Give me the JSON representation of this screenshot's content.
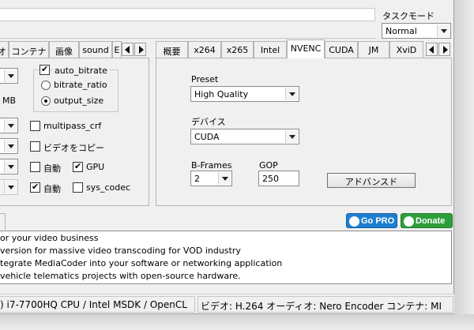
{
  "taskmode": {
    "label": "タスクモード",
    "value": "Normal"
  },
  "left_tabs": [
    "オ",
    "コンテナ",
    "画像",
    "sound",
    "E"
  ],
  "right_tabs": [
    "概要",
    "x264",
    "x265",
    "Intel",
    "NVENC",
    "CUDA",
    "JM",
    "XviD"
  ],
  "right_active_tab": "NVENC",
  "left_panel": {
    "mb_label": "MB",
    "auto_bitrate": "auto_bitrate",
    "bitrate_ratio": "bitrate_ratio",
    "output_size": "output_size",
    "multipass_crf": "multipass_crf",
    "copy_video": "ビデオをコピー",
    "auto1": "自動",
    "gpu": "GPU",
    "auto2": "自動",
    "sys_codec": "sys_codec"
  },
  "nvenc": {
    "preset_label": "Preset",
    "preset_value": "High Quality",
    "device_label": "デバイス",
    "device_value": "CUDA",
    "bframes_label": "B-Frames",
    "bframes_value": "2",
    "gop_label": "GOP",
    "gop_value": "250",
    "advanced_button": "アドバンスド"
  },
  "promo": {
    "gopro": "Go PRO",
    "donate": "Donate"
  },
  "news": [
    "or your video business",
    " version for massive video transcoding for VOD industry",
    "tegrate MediaCoder into your software or networking application",
    "vehicle telematics projects with open-source hardware."
  ],
  "status": {
    "cpu": ") i7-7700HQ CPU  / Intel MSDK / OpenCL",
    "summary": "ビデオ: H.264  オーディオ: Nero Encoder  コンテナ: MI"
  },
  "colors": {
    "gopro": "#1e7fd0",
    "donate": "#2e9e3a",
    "active_tab": "#ffffff",
    "window": "#f0f0f0"
  }
}
